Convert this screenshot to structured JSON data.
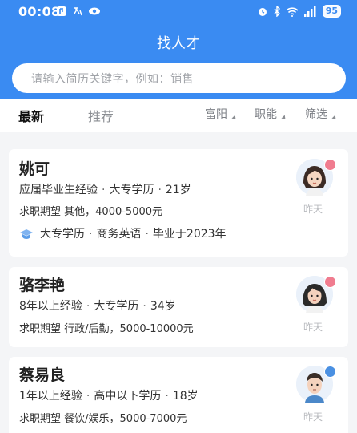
{
  "status_bar": {
    "time": "00:08",
    "battery": "95"
  },
  "header": {
    "title": "找人才"
  },
  "search": {
    "placeholder": "请输入简历关键字，例如：销售"
  },
  "tabs": {
    "active": "最新",
    "inactive": "推荐"
  },
  "filters": [
    "富阳",
    "职能",
    "筛选"
  ],
  "candidates": [
    {
      "name": "姚可",
      "experience": "应届毕业生经验",
      "education": "大专学历",
      "age": "21岁",
      "expect_label": "求职期望",
      "expect": "其他，4000-5000元",
      "edu_line": [
        "大专学历",
        "商务英语",
        "毕业于2023年"
      ],
      "time": "昨天",
      "gender": "female"
    },
    {
      "name": "骆李艳",
      "experience": "8年以上经验",
      "education": "大专学历",
      "age": "34岁",
      "expect_label": "求职期望",
      "expect": "行政/后勤，5000-10000元",
      "time": "昨天",
      "gender": "female"
    },
    {
      "name": "蔡易良",
      "experience": "1年以上经验",
      "education": "高中以下学历",
      "age": "18岁",
      "expect_label": "求职期望",
      "expect": "餐饮/娱乐，5000-7000元",
      "time": "昨天",
      "gender": "male"
    }
  ],
  "colors": {
    "brand": "#3a8bf2",
    "female_badge": "#f07c8f",
    "male_badge": "#4a90e2"
  }
}
